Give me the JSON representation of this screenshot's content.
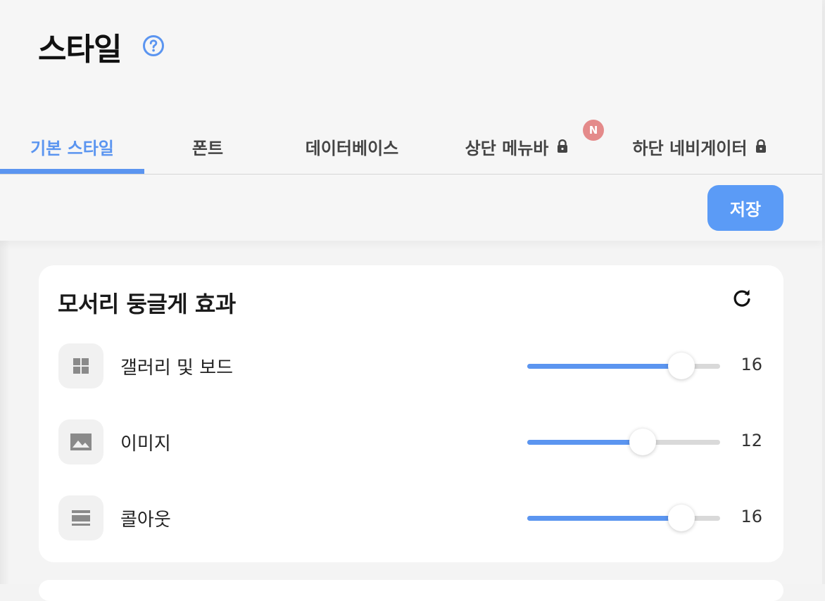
{
  "page": {
    "title": "스타일",
    "help_icon": "question-circle-icon"
  },
  "tabs": [
    {
      "label": "기본 스타일",
      "active": true,
      "locked": false
    },
    {
      "label": "폰트",
      "active": false,
      "locked": false
    },
    {
      "label": "데이터베이스",
      "active": false,
      "locked": false
    },
    {
      "label": "상단 메뉴바",
      "active": false,
      "locked": true
    },
    {
      "label": "하단 네비게이터",
      "active": false,
      "locked": true
    }
  ],
  "new_badge": "N",
  "toolbar": {
    "save_label": "저장"
  },
  "card": {
    "title": "모서리 둥글게 효과",
    "reset_icon": "refresh-icon",
    "rows": [
      {
        "label": "갤러리 및 보드",
        "icon": "grid-icon",
        "value": "16",
        "slider_fraction": 0.8
      },
      {
        "label": "이미지",
        "icon": "image-icon",
        "value": "12",
        "slider_fraction": 0.6
      },
      {
        "label": "콜아웃",
        "icon": "callout-icon",
        "value": "16",
        "slider_fraction": 0.8
      }
    ]
  },
  "colors": {
    "accent": "#5b95f0",
    "save_button": "#5b9bf6",
    "badge": "#e48a8a"
  }
}
